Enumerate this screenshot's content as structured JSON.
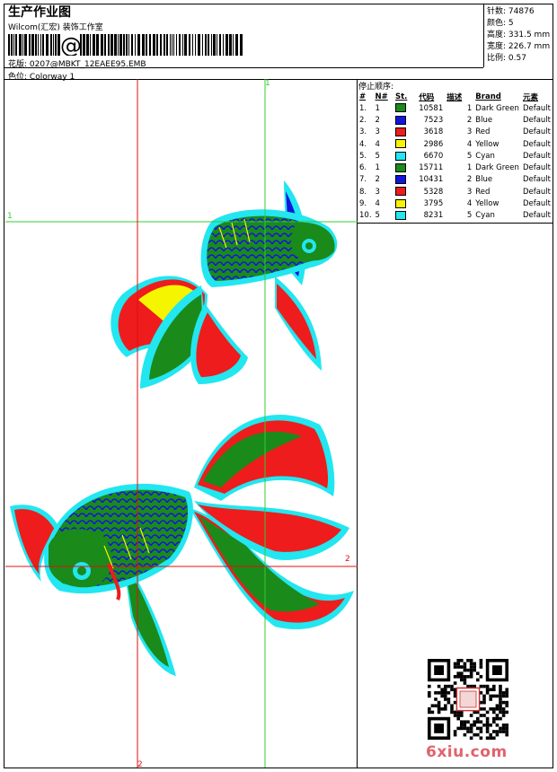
{
  "header": {
    "title": "生产作业图",
    "company": "Wilcom(汇宏) 装饰工作室",
    "design_label": "花版:",
    "design_value": "0207@MBKT_12EAEE95.EMB",
    "colorway_label": "色位:",
    "colorway_value": "Colorway 1"
  },
  "info": [
    {
      "label": "针数:",
      "value": "74876"
    },
    {
      "label": "颜色:",
      "value": "5"
    },
    {
      "label": "高度:",
      "value": "331.5 mm"
    },
    {
      "label": "宽度:",
      "value": "226.7 mm"
    },
    {
      "label": "比例:",
      "value": "0.57"
    }
  ],
  "stop_sequence": {
    "header": "停止顺序:",
    "columns": [
      "#",
      "N#",
      "St.",
      "代码",
      "描述",
      "Brand",
      "元素"
    ],
    "rows": [
      {
        "idx": "1.",
        "n": "1",
        "color": "#1a8a1a",
        "st": "10581",
        "code": "1",
        "desc": "Dark Green",
        "brand": "Default"
      },
      {
        "idx": "2.",
        "n": "2",
        "color": "#1414e0",
        "st": "7523",
        "code": "2",
        "desc": "Blue",
        "brand": "Default"
      },
      {
        "idx": "3.",
        "n": "3",
        "color": "#ee1c1c",
        "st": "3618",
        "code": "3",
        "desc": "Red",
        "brand": "Default"
      },
      {
        "idx": "4.",
        "n": "4",
        "color": "#f5f500",
        "st": "2986",
        "code": "4",
        "desc": "Yellow",
        "brand": "Default"
      },
      {
        "idx": "5.",
        "n": "5",
        "color": "#22e6f0",
        "st": "6670",
        "code": "5",
        "desc": "Cyan",
        "brand": "Default"
      },
      {
        "idx": "6.",
        "n": "1",
        "color": "#1a8a1a",
        "st": "15711",
        "code": "1",
        "desc": "Dark Green",
        "brand": "Default"
      },
      {
        "idx": "7.",
        "n": "2",
        "color": "#1414e0",
        "st": "10431",
        "code": "2",
        "desc": "Blue",
        "brand": "Default"
      },
      {
        "idx": "8.",
        "n": "3",
        "color": "#ee1c1c",
        "st": "5328",
        "code": "3",
        "desc": "Red",
        "brand": "Default"
      },
      {
        "idx": "9.",
        "n": "4",
        "color": "#f5f500",
        "st": "3795",
        "code": "4",
        "desc": "Yellow",
        "brand": "Default"
      },
      {
        "idx": "10.",
        "n": "5",
        "color": "#22e6f0",
        "st": "8231",
        "code": "5",
        "desc": "Cyan",
        "brand": "Default"
      }
    ]
  },
  "markers": {
    "green_top": "1",
    "green_left": "1",
    "red_right": "2",
    "red_bottom": "2"
  },
  "watermark": "6xiu.com",
  "colors": {
    "guide_green": "#33cc33",
    "guide_red": "#e01010",
    "dark_green": "#1a8a1a",
    "blue": "#1414e0",
    "red": "#ee1c1c",
    "yellow": "#f5f500",
    "cyan": "#22e6f0"
  }
}
